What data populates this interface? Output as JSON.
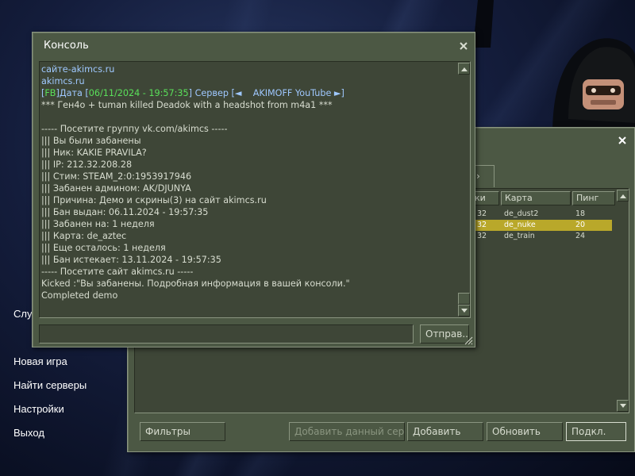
{
  "background": {
    "menu": {
      "hidden_item": "Слу",
      "items": [
        "Новая игра",
        "Найти серверы",
        "Настройки",
        "Выход"
      ]
    }
  },
  "server_browser": {
    "tab_partial": "›",
    "columns": [
      "ки",
      "Карта",
      "Пинг"
    ],
    "rows": [
      {
        "players": "32",
        "map": "de_dust2",
        "ping": "18",
        "selected": false
      },
      {
        "players": "32",
        "map": "de_nuke",
        "ping": "20",
        "selected": true
      },
      {
        "players": "32",
        "map": "de_train",
        "ping": "24",
        "selected": false
      }
    ],
    "buttons": {
      "filters": "Фильтры",
      "add_current": "Добавить данный сер...",
      "add": "Добавить",
      "refresh": "Обновить",
      "connect": "Подкл."
    }
  },
  "console": {
    "title": "Консоль",
    "send_label": "Отправ...",
    "input_value": "",
    "lines": [
      [
        {
          "t": "сайте-akimcs.ru",
          "c": "blue"
        }
      ],
      [
        {
          "t": "akimcs.ru",
          "c": "blue"
        }
      ],
      [
        {
          "t": "[",
          "c": "blue"
        },
        {
          "t": "FB",
          "c": "green"
        },
        {
          "t": "]Дата [",
          "c": "blue"
        },
        {
          "t": "06/11/2024 - 19:57:35",
          "c": "green"
        },
        {
          "t": "] Сервер [◄    AKIMOFF YouTube ►]",
          "c": "blue"
        }
      ],
      [
        {
          "t": "*** Ген4о + tuman killed Deadok with a headshot from m4a1 ***",
          "c": "text"
        }
      ],
      [
        {
          "t": "",
          "c": "text"
        }
      ],
      [
        {
          "t": "----- Посетите группу vk.com/akimcs -----",
          "c": "text"
        }
      ],
      [
        {
          "t": "||| Вы были забанены",
          "c": "text"
        }
      ],
      [
        {
          "t": "||| Ник: KAKIE PRAVILA?",
          "c": "text"
        }
      ],
      [
        {
          "t": "||| IP: 212.32.208.28",
          "c": "text"
        }
      ],
      [
        {
          "t": "||| Стим: STEAM_2:0:1953917946",
          "c": "text"
        }
      ],
      [
        {
          "t": "||| Забанен админом: AK/DJUNYA",
          "c": "text"
        }
      ],
      [
        {
          "t": "||| Причина: Демо и скрины(3) на сайт akimcs.ru",
          "c": "text"
        }
      ],
      [
        {
          "t": "||| Бан выдан: 06.11.2024 - 19:57:35",
          "c": "text"
        }
      ],
      [
        {
          "t": "||| Забанен на: 1 неделя",
          "c": "text"
        }
      ],
      [
        {
          "t": "||| Карта: de_aztec",
          "c": "text"
        }
      ],
      [
        {
          "t": "||| Еще осталось: 1 неделя",
          "c": "text"
        }
      ],
      [
        {
          "t": "||| Бан истекает: 13.11.2024 - 19:57:35",
          "c": "text"
        }
      ],
      [
        {
          "t": "----- Посетите сайт akimcs.ru -----",
          "c": "text"
        }
      ],
      [
        {
          "t": "Kicked :\"Вы забанены. Подробная информация в вашей консоли.\"",
          "c": "text"
        }
      ],
      [
        {
          "t": "Completed demo",
          "c": "text"
        }
      ]
    ]
  },
  "colors": {
    "panel": "#4c5844",
    "panel_dark": "#3e4637",
    "text": "#d8ddd0",
    "link_blue": "#9fc8ff",
    "highlight_green": "#5ae05a",
    "selection": "#b9a82a"
  },
  "icons": {
    "close": "close-x-icon",
    "scroll_up": "arrow-up-icon",
    "scroll_down": "arrow-down-icon",
    "resize": "resize-grip-icon"
  }
}
